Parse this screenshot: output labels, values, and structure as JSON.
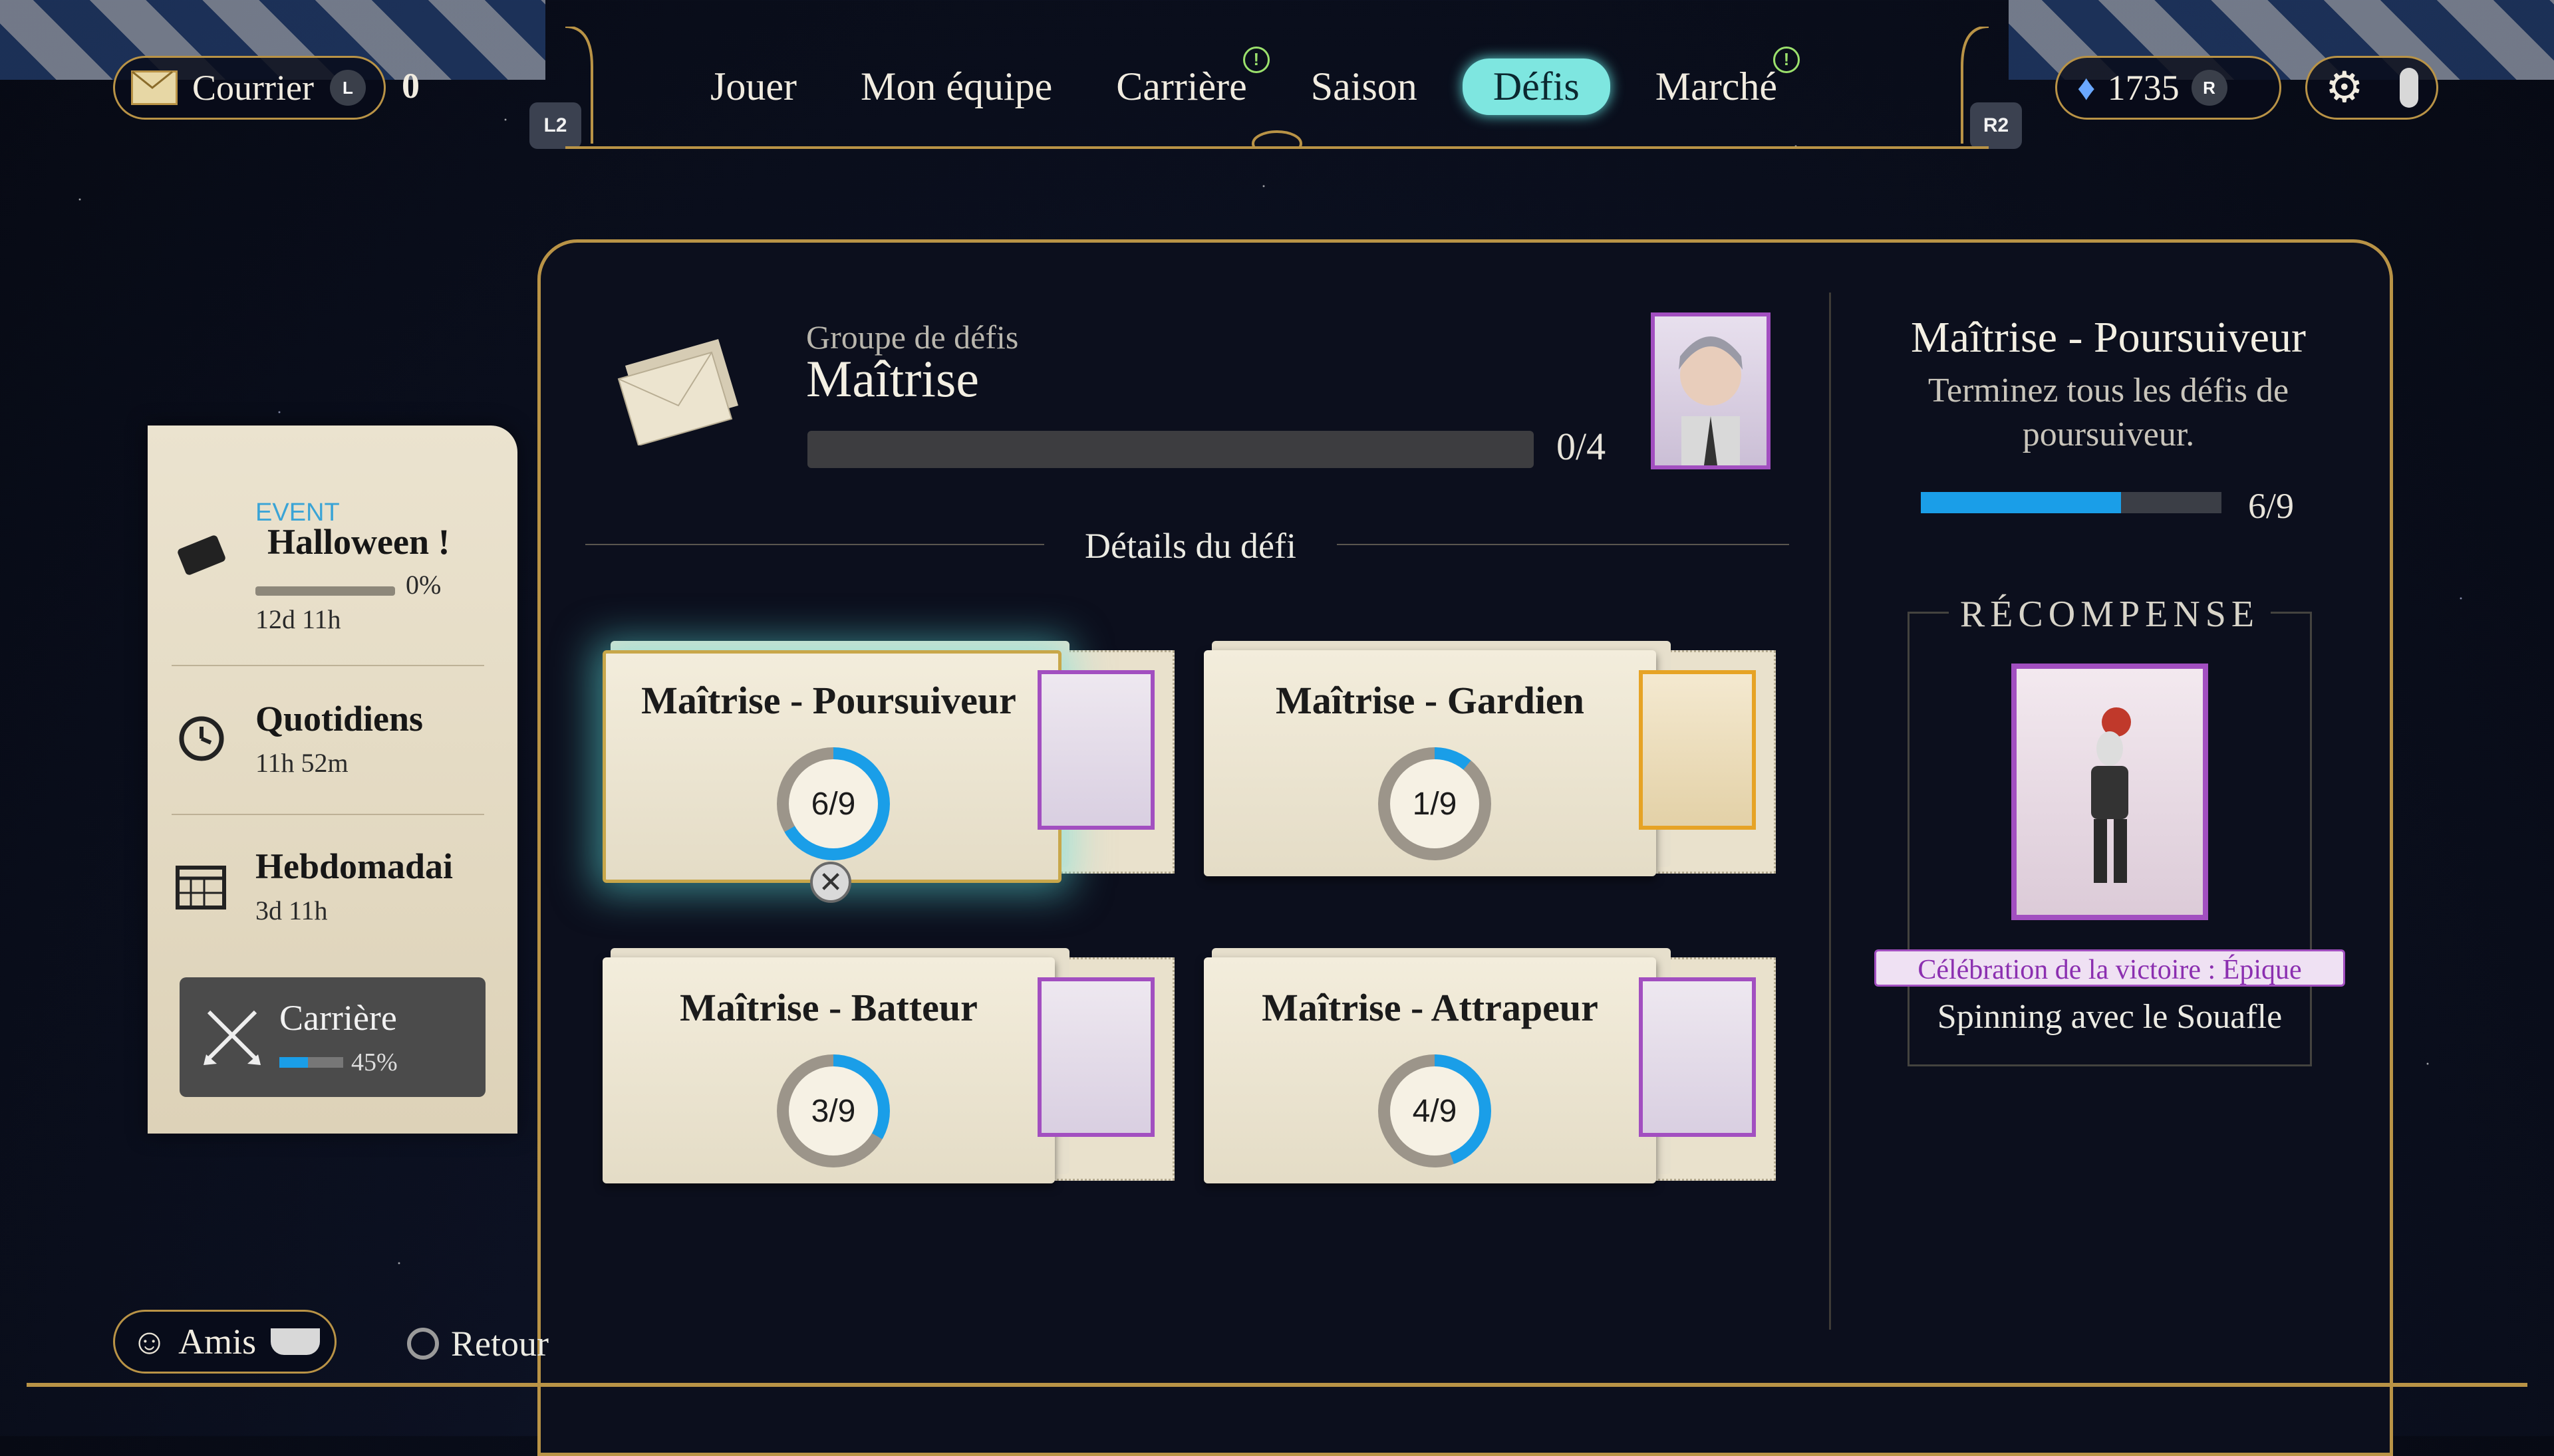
{
  "topbar": {
    "mail_label": "Courrier",
    "mail_button": "L",
    "mail_count": "0",
    "left_trigger": "L2",
    "right_trigger": "R2",
    "currency_value": "1735",
    "currency_button": "R"
  },
  "nav": {
    "tabs": [
      {
        "label": "Jouer",
        "alert": false,
        "active": false
      },
      {
        "label": "Mon équipe",
        "alert": false,
        "active": false
      },
      {
        "label": "Carrière",
        "alert": true,
        "active": false
      },
      {
        "label": "Saison",
        "alert": false,
        "active": false
      },
      {
        "label": "Défis",
        "alert": false,
        "active": true
      },
      {
        "label": "Marché",
        "alert": true,
        "active": false
      }
    ],
    "alert_glyph": "!"
  },
  "sidebar": {
    "event_tag": "EVENT",
    "items": [
      {
        "title": "Halloween !",
        "progress_text": "0%",
        "progress": 0,
        "time": "12d 11h",
        "icon": "ticket-icon"
      },
      {
        "title": "Quotidiens",
        "time": "11h 52m",
        "icon": "daily-clock-icon"
      },
      {
        "title": "Hebdomadai",
        "time": "3d 11h",
        "icon": "calendar-icon"
      },
      {
        "title": "Carrière",
        "progress_text": "45%",
        "progress": 45,
        "icon": "crossed-brooms-icon"
      }
    ]
  },
  "group": {
    "label": "Groupe de défis",
    "title": "Maîtrise",
    "progress_text": "0/4",
    "progress": 0
  },
  "details_title": "Détails du défi",
  "cards": [
    {
      "name": "Maîtrise - Poursuiveur",
      "count": "6/9",
      "progress": 0.667,
      "rarity_color": "#a24fc0",
      "selected": true
    },
    {
      "name": "Maîtrise - Gardien",
      "count": "1/9",
      "progress": 0.111,
      "rarity_color": "#e6a325",
      "selected": false
    },
    {
      "name": "Maîtrise - Batteur",
      "count": "3/9",
      "progress": 0.333,
      "rarity_color": "#a24fc0",
      "selected": false
    },
    {
      "name": "Maîtrise - Attrapeur",
      "count": "4/9",
      "progress": 0.444,
      "rarity_color": "#a24fc0",
      "selected": false
    }
  ],
  "detail": {
    "title": "Maîtrise - Poursuiveur",
    "description": "Terminez tous les défis de poursuiveur.",
    "progress_text": "6/9",
    "progress": 0.667,
    "reward_heading": "RÉCOMPENSE",
    "reward_rarity": "Célébration de la victoire : Épique",
    "reward_name": "Spinning avec le Souafle"
  },
  "footer": {
    "friends_label": "Amis",
    "back_label": "Retour"
  },
  "colors": {
    "gold": "#b99346",
    "active_tab": "#7ee6e0",
    "progress_blue": "#1a9ee8",
    "epic_purple": "#a24fc0",
    "legendary_gold": "#e6a325"
  }
}
